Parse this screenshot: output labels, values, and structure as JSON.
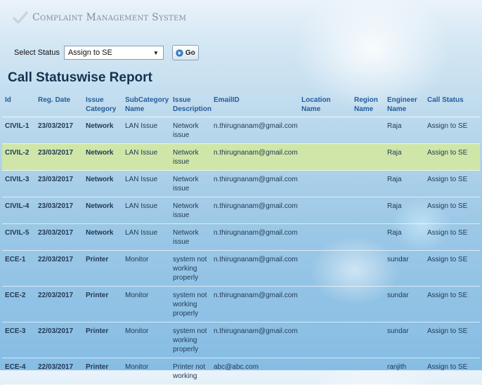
{
  "header": {
    "app_title": "Complaint Management System"
  },
  "filter": {
    "label": "Select Status",
    "selected": "Assign to SE",
    "go_label": "Go"
  },
  "report": {
    "title": "Call Statuswise Report",
    "columns": {
      "id": "Id",
      "reg_date": "Reg. Date",
      "issue_category": "Issue Category",
      "subcategory": "SubCategory Name",
      "issue_description": "Issue Description",
      "email": "EmailID",
      "location": "Location Name",
      "region": "Region Name",
      "engineer": "Engineer Name",
      "call_status": "Call Status"
    },
    "rows": [
      {
        "id": "CIVIL-1",
        "reg_date": "23/03/2017",
        "issue_category": "Network",
        "subcategory": "LAN Issue",
        "issue_description": "Network issue",
        "email": "n.thirugnanam@gmail.com",
        "location": "",
        "region": "",
        "engineer": "Raja",
        "call_status": "Assign to SE"
      },
      {
        "id": "CIVIL-2",
        "reg_date": "23/03/2017",
        "issue_category": "Network",
        "subcategory": "LAN Issue",
        "issue_description": "Network issue",
        "email": "n.thirugnanam@gmail.com",
        "location": "",
        "region": "",
        "engineer": "Raja",
        "call_status": "Assign to SE"
      },
      {
        "id": "CIVIL-3",
        "reg_date": "23/03/2017",
        "issue_category": "Network",
        "subcategory": "LAN Issue",
        "issue_description": "Network issue",
        "email": "n.thirugnanam@gmail.com",
        "location": "",
        "region": "",
        "engineer": "Raja",
        "call_status": "Assign to SE"
      },
      {
        "id": "CIVIL-4",
        "reg_date": "23/03/2017",
        "issue_category": "Network",
        "subcategory": "LAN Issue",
        "issue_description": "Network issue",
        "email": "n.thirugnanam@gmail.com",
        "location": "",
        "region": "",
        "engineer": "Raja",
        "call_status": "Assign to SE"
      },
      {
        "id": "CIVIL-5",
        "reg_date": "23/03/2017",
        "issue_category": "Network",
        "subcategory": "LAN Issue",
        "issue_description": "Network issue",
        "email": "n.thirugnanam@gmail.com",
        "location": "",
        "region": "",
        "engineer": "Raja",
        "call_status": "Assign to SE"
      },
      {
        "id": "ECE-1",
        "reg_date": "22/03/2017",
        "issue_category": "Printer",
        "subcategory": "Monitor",
        "issue_description": "system not working properly",
        "email": "n.thirugnanam@gmail.com",
        "location": "",
        "region": "",
        "engineer": "sundar",
        "call_status": "Assign to SE"
      },
      {
        "id": "ECE-2",
        "reg_date": "22/03/2017",
        "issue_category": "Printer",
        "subcategory": "Monitor",
        "issue_description": "system not working properly",
        "email": "n.thirugnanam@gmail.com",
        "location": "",
        "region": "",
        "engineer": "sundar",
        "call_status": "Assign to SE"
      },
      {
        "id": "ECE-3",
        "reg_date": "22/03/2017",
        "issue_category": "Printer",
        "subcategory": "Monitor",
        "issue_description": "system not working properly",
        "email": "n.thirugnanam@gmail.com",
        "location": "",
        "region": "",
        "engineer": "sundar",
        "call_status": "Assign to SE"
      },
      {
        "id": "ECE-4",
        "reg_date": "22/03/2017",
        "issue_category": "Printer",
        "subcategory": "Monitor",
        "issue_description": "Printer not working",
        "email": "abc@abc.com",
        "location": "",
        "region": "",
        "engineer": "ranjith",
        "call_status": "Assign to SE"
      }
    ],
    "highlighted_row": 1
  },
  "colors": {
    "header_text": "#245d9c",
    "cell_text": "#233a55",
    "highlight_row": "#cfe6a8",
    "title_text": "#16324f",
    "check_mark": "#c9d3dd"
  }
}
